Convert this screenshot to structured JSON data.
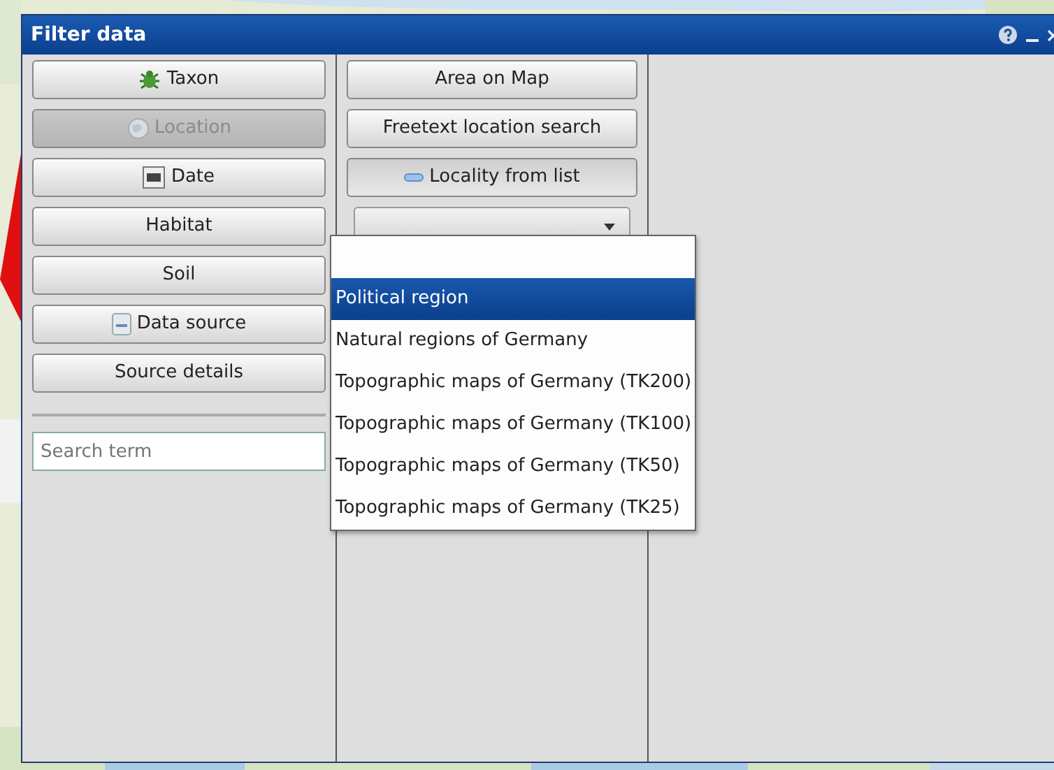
{
  "window": {
    "title": "Filter data"
  },
  "left_buttons": [
    {
      "label": "Taxon",
      "disabled": false
    },
    {
      "label": "Location",
      "disabled": true
    },
    {
      "label": "Date",
      "disabled": false
    },
    {
      "label": "Habitat",
      "disabled": false
    },
    {
      "label": "Soil",
      "disabled": false
    },
    {
      "label": "Data source",
      "disabled": false
    },
    {
      "label": "Source details",
      "disabled": false
    }
  ],
  "search": {
    "placeholder": "Search term"
  },
  "middle_buttons": [
    {
      "label": "Area on Map",
      "pressed": false
    },
    {
      "label": "Freetext location search",
      "pressed": false
    },
    {
      "label": "Locality from list",
      "pressed": true
    }
  ],
  "dropdown": {
    "expanded": true,
    "options": [
      {
        "selected": false
      },
      {
        "label": "Political region",
        "selected": true
      },
      {
        "label": "Natural regions of Germany",
        "selected": false
      },
      {
        "label": "Topographic maps of Germany (TK200)",
        "selected": false
      },
      {
        "label": "Topographic maps of Germany (TK100)",
        "selected": false
      },
      {
        "label": "Topographic maps of Germany (TK50)",
        "selected": false
      },
      {
        "label": "Topographic maps of Germany (TK25)",
        "selected": false
      }
    ]
  }
}
